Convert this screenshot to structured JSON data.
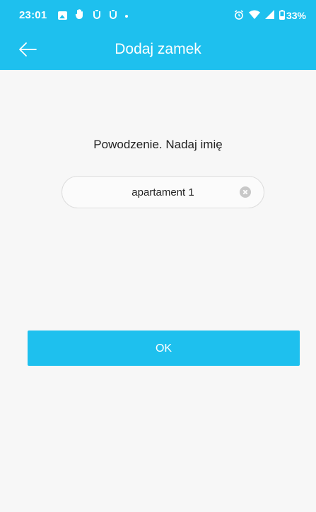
{
  "status_bar": {
    "time": "23:01",
    "battery_percent": "33%",
    "icons_left": [
      "image-icon",
      "hand-icon",
      "mi-icon",
      "mi-icon",
      "dot-icon"
    ],
    "icons_right": [
      "alarm-icon",
      "wifi-icon",
      "signal-icon",
      "battery-icon"
    ]
  },
  "app_bar": {
    "title": "Dodaj zamek",
    "background_color": "#1ec0ee"
  },
  "content": {
    "prompt": "Powodzenie. Nadaj imię",
    "name_input_value": "apartament 1",
    "ok_label": "OK"
  },
  "colors": {
    "accent": "#1ec0ee",
    "background": "#f7f7f7"
  }
}
